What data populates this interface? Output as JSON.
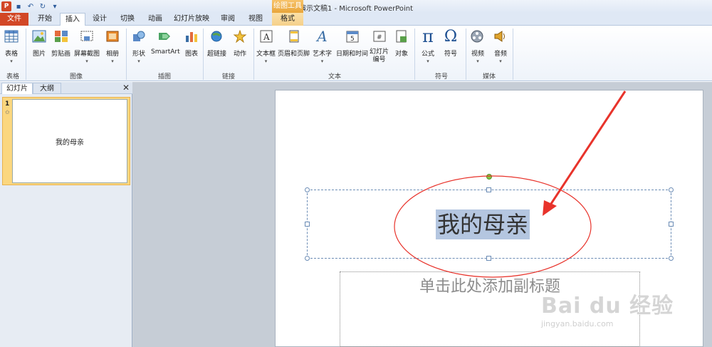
{
  "window": {
    "title": "演示文稿1 - Microsoft PowerPoint",
    "contextual_group": "绘图工具"
  },
  "tabs": [
    "文件",
    "开始",
    "插入",
    "设计",
    "切换",
    "动画",
    "幻灯片放映",
    "审阅",
    "视图",
    "格式"
  ],
  "ribbon": {
    "buttons": {
      "table": "表格",
      "picture": "图片",
      "clipart": "剪贴画",
      "screenshot": "屏幕截图",
      "album": "相册",
      "shapes": "形状",
      "smartart": "SmartArt",
      "chart": "图表",
      "hyperlink": "超链接",
      "action": "动作",
      "textbox": "文本框",
      "header_footer": "页眉和页脚",
      "wordart": "艺术字",
      "datetime": "日期和时间",
      "slide_number_1": "幻灯片",
      "slide_number_2": "编号",
      "object": "对象",
      "equation": "公式",
      "symbol": "符号",
      "video": "视频",
      "audio": "音频"
    },
    "groups": {
      "tables": "表格",
      "images": "图像",
      "illustrations": "插图",
      "links": "链接",
      "text": "文本",
      "symbols": "符号",
      "media": "媒体"
    }
  },
  "left_pane": {
    "tab_slides": "幻灯片",
    "tab_outline": "大纲",
    "close": "✕",
    "thumbnail": {
      "number": "1",
      "star": "✩",
      "text": "我的母亲"
    }
  },
  "slide": {
    "title": "我的母亲",
    "subtitle_placeholder": "单击此处添加副标题"
  },
  "watermark": {
    "main": "Bai du 经验",
    "sub": "jingyan.baidu.com"
  },
  "colors": {
    "file_tab": "#d24726",
    "annotation_red": "#e8332b",
    "selection_highlight": "#b4c6e0",
    "contextual_tab": "#e8a53a"
  }
}
